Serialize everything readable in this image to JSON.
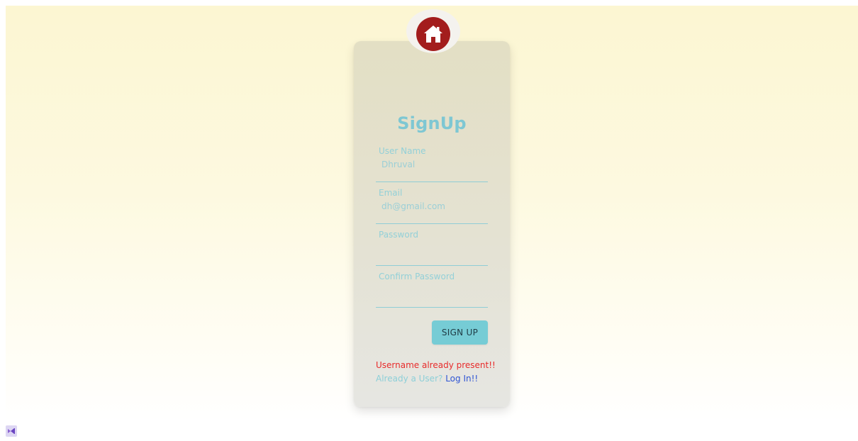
{
  "app": {
    "logo_icon": "home-icon",
    "logo_color": "#a31d1d"
  },
  "form": {
    "title": "SignUp",
    "fields": [
      {
        "label": "User Name",
        "value": "Dhruval",
        "type": "text"
      },
      {
        "label": "Email",
        "value": "dh@gmail.com",
        "type": "email"
      },
      {
        "label": "Password",
        "value": "",
        "type": "password"
      },
      {
        "label": "Confirm Password",
        "value": "",
        "type": "password"
      }
    ],
    "submit_label": "SIGN UP",
    "error_message": "Username already present!!",
    "login_prompt": "Already a User?",
    "login_link": "Log In!!"
  },
  "colors": {
    "accent": "#7ec7d3",
    "button": "#76ccd5",
    "error": "#e82b2b",
    "link": "#2f55d4"
  },
  "taskbar": {
    "icon": "visual-studio-icon"
  }
}
